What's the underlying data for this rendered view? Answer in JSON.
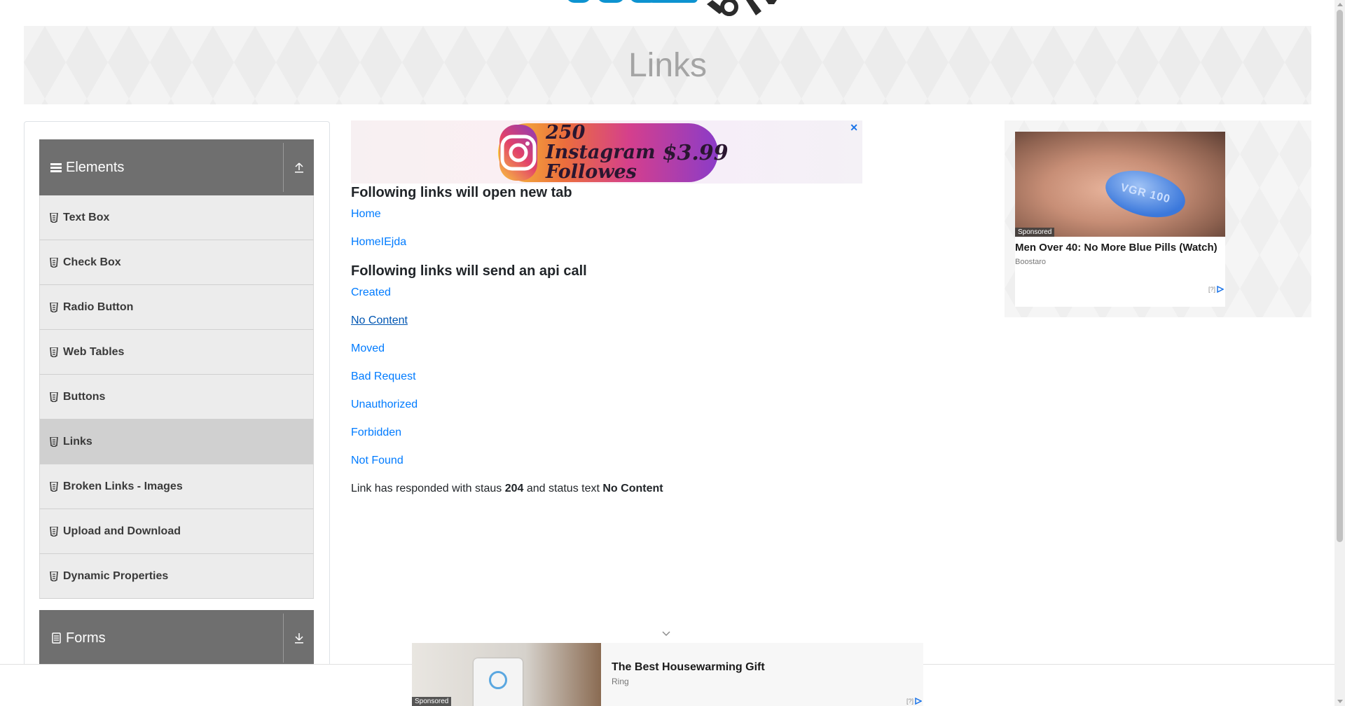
{
  "page": {
    "title": "Links"
  },
  "sidebar": {
    "groups": [
      {
        "label": "Elements",
        "icon": "hamburger-icon",
        "toggle_icon": "collapse-up-icon",
        "items": [
          {
            "label": "Text Box"
          },
          {
            "label": "Check Box"
          },
          {
            "label": "Radio Button"
          },
          {
            "label": "Web Tables"
          },
          {
            "label": "Buttons"
          },
          {
            "label": "Links",
            "active": true
          },
          {
            "label": "Broken Links - Images"
          },
          {
            "label": "Upload and Download"
          },
          {
            "label": "Dynamic Properties"
          }
        ]
      },
      {
        "label": "Forms",
        "icon": "document-icon",
        "toggle_icon": "expand-down-icon"
      }
    ]
  },
  "main": {
    "new_tab_heading": "Following links will open new tab",
    "new_tab_links": [
      "Home",
      "HomeIEjda"
    ],
    "api_heading": "Following links will send an api call",
    "api_links": [
      "Created",
      "No Content",
      "Moved",
      "Bad Request",
      "Unauthorized",
      "Forbidden",
      "Not Found"
    ],
    "response": {
      "prefix": "Link has responded with staus",
      "status_code": "204",
      "middle": "and status text",
      "status_text": "No Content"
    }
  },
  "ads": {
    "top_banner": {
      "text": "250 Instagram Followes",
      "price": "$3.99",
      "close": "✕"
    },
    "right": {
      "sponsored": "Sponsored",
      "pill_text": "VGR 100",
      "headline": "Men Over 40: No More Blue Pills (Watch)",
      "brand": "Boostaro",
      "adchoices": "[?]"
    },
    "bottom": {
      "sponsored": "Sponsored",
      "title": "The Best Housewarming Gift",
      "brand": "Ring",
      "adchoices": "[?]"
    }
  },
  "colors": {
    "link": "#007bff",
    "sidebar_header": "#6f6f6f",
    "menu_item": "#ececec",
    "menu_item_active": "#d0d0d0",
    "banner_title": "#a4a4a4"
  }
}
